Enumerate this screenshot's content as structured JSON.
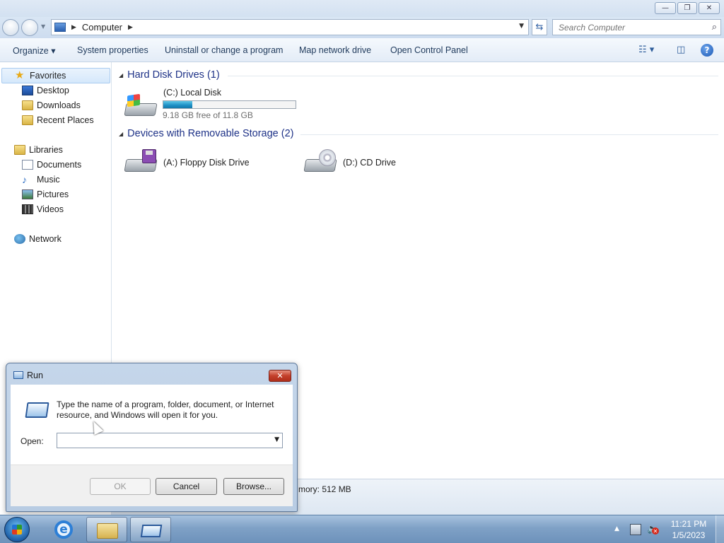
{
  "window": {
    "minimize_glyph": "—",
    "maximize_glyph": "❐",
    "close_glyph": "✕"
  },
  "address": {
    "crumb": "Computer",
    "search_placeholder": "Search Computer"
  },
  "toolbar": {
    "organize": "Organize ▾",
    "system_properties": "System properties",
    "uninstall": "Uninstall or change a program",
    "map_drive": "Map network drive",
    "control_panel": "Open Control Panel",
    "help_glyph": "?"
  },
  "navpane": {
    "favorites": "Favorites",
    "desktop": "Desktop",
    "downloads": "Downloads",
    "recent": "Recent Places",
    "libraries": "Libraries",
    "documents": "Documents",
    "music": "Music",
    "pictures": "Pictures",
    "videos": "Videos",
    "network": "Network"
  },
  "content": {
    "hdd_group": "Hard Disk Drives (1)",
    "removable_group": "Devices with Removable Storage (2)",
    "local_disk": "(C:) Local Disk",
    "local_disk_free": "9.18 GB free of 11.8 GB",
    "local_disk_used_fraction": 0.22,
    "floppy": "(A:) Floppy Disk Drive",
    "cd": "(D:) CD Drive"
  },
  "statusbar": {
    "memory": "mory: 512 MB"
  },
  "run_dialog": {
    "title": "Run",
    "close_glyph": "✕",
    "description": "Type the name of a program, folder, document, or Internet resource, and Windows will open it for you.",
    "open_label": "Open:",
    "open_value": "",
    "ok": "OK",
    "cancel": "Cancel",
    "browse": "Browse..."
  },
  "taskbar": {
    "ie_glyph": "e",
    "time": "11:21 PM",
    "date": "1/5/2023"
  },
  "colors": {
    "accent": "#1e3287",
    "capacity_fill": "#1d8fc4",
    "close_red": "#c3402b"
  }
}
